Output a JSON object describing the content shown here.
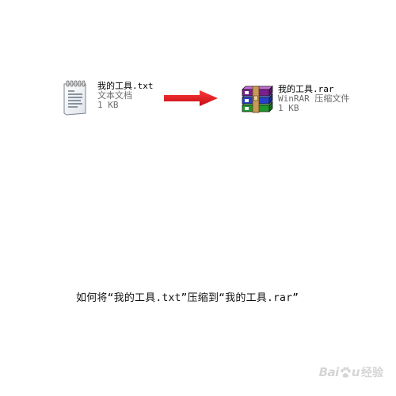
{
  "source_file": {
    "name": "我的工具.txt",
    "type": "文本文档",
    "size": "1 KB",
    "icon": "notepad-icon"
  },
  "target_file": {
    "name": "我的工具.rar",
    "type": "WinRAR 压缩文件",
    "size": "1 KB",
    "icon": "winrar-archive-icon"
  },
  "arrow": {
    "icon": "arrow-right-icon",
    "color": "#e4161e"
  },
  "caption": "如何将“我的工具.txt”压缩到“我的工具.rar”",
  "watermark": {
    "brand": "Bai",
    "brand_tail": "u",
    "sub": "经验",
    "icon": "baidu-paw-icon"
  }
}
